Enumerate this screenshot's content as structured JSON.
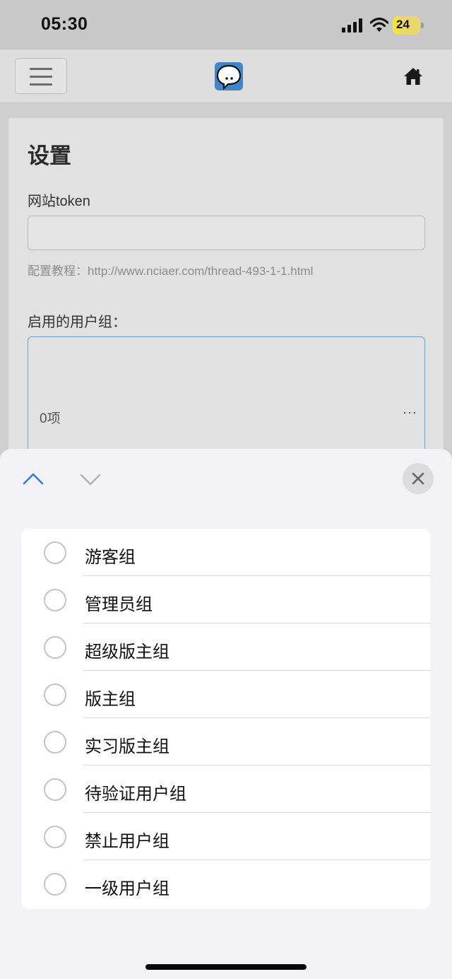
{
  "status_bar": {
    "time": "05:30",
    "battery": "24"
  },
  "settings": {
    "title": "设置",
    "token_label": "网站token",
    "token_value": "",
    "help_text": "配置教程：http://www.nciaer.com/thread-493-1-1.html",
    "groups_label": "启用的用户组：",
    "selected_count": "0项",
    "more": "···"
  },
  "picker": {
    "options": [
      {
        "label": "游客组"
      },
      {
        "label": "管理员组"
      },
      {
        "label": "超级版主组"
      },
      {
        "label": "版主组"
      },
      {
        "label": "实习版主组"
      },
      {
        "label": "待验证用户组"
      },
      {
        "label": "禁止用户组"
      },
      {
        "label": "一级用户组"
      }
    ]
  },
  "colors": {
    "accent": "#3478f6",
    "disabled_arrow": "#b0b0b8",
    "logo_blue": "#3f86c9"
  },
  "icons": {
    "menu": "hamburger-icon",
    "home": "home-icon",
    "up": "chevron-up-icon",
    "down": "chevron-down-icon",
    "close": "close-icon"
  }
}
